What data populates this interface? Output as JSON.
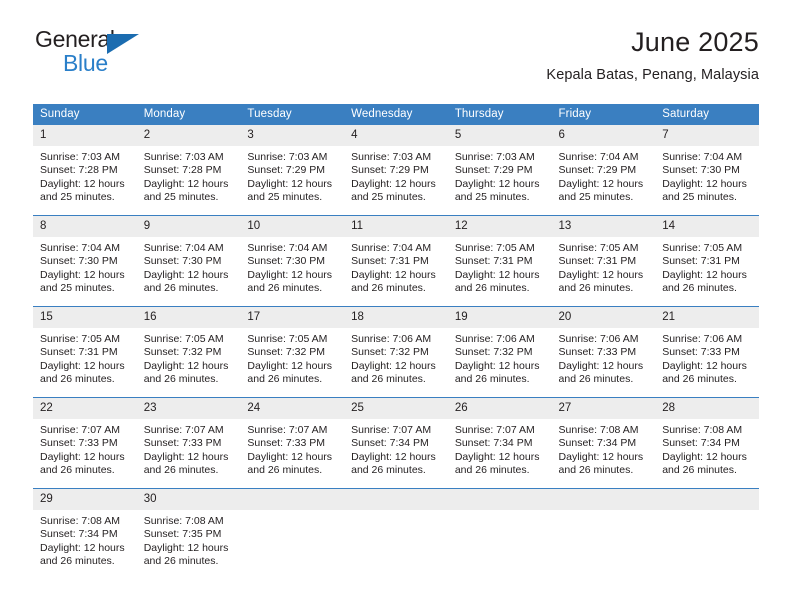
{
  "brand": {
    "name_part1": "General",
    "name_part2": "Blue",
    "triangle_color": "#1b6cb0",
    "blue_color": "#2a7fc9"
  },
  "header": {
    "title": "June 2025",
    "subtitle": "Kepala Batas, Penang, Malaysia"
  },
  "theme": {
    "header_bg": "#3a7fc1",
    "daynum_bg": "#ededed",
    "text": "#231f20",
    "row_divider": "#3a7fc1"
  },
  "weekdays": [
    "Sunday",
    "Monday",
    "Tuesday",
    "Wednesday",
    "Thursday",
    "Friday",
    "Saturday"
  ],
  "weeks": [
    [
      {
        "day": "1",
        "sunrise": "Sunrise: 7:03 AM",
        "sunset": "Sunset: 7:28 PM",
        "daylight1": "Daylight: 12 hours",
        "daylight2": "and 25 minutes."
      },
      {
        "day": "2",
        "sunrise": "Sunrise: 7:03 AM",
        "sunset": "Sunset: 7:28 PM",
        "daylight1": "Daylight: 12 hours",
        "daylight2": "and 25 minutes."
      },
      {
        "day": "3",
        "sunrise": "Sunrise: 7:03 AM",
        "sunset": "Sunset: 7:29 PM",
        "daylight1": "Daylight: 12 hours",
        "daylight2": "and 25 minutes."
      },
      {
        "day": "4",
        "sunrise": "Sunrise: 7:03 AM",
        "sunset": "Sunset: 7:29 PM",
        "daylight1": "Daylight: 12 hours",
        "daylight2": "and 25 minutes."
      },
      {
        "day": "5",
        "sunrise": "Sunrise: 7:03 AM",
        "sunset": "Sunset: 7:29 PM",
        "daylight1": "Daylight: 12 hours",
        "daylight2": "and 25 minutes."
      },
      {
        "day": "6",
        "sunrise": "Sunrise: 7:04 AM",
        "sunset": "Sunset: 7:29 PM",
        "daylight1": "Daylight: 12 hours",
        "daylight2": "and 25 minutes."
      },
      {
        "day": "7",
        "sunrise": "Sunrise: 7:04 AM",
        "sunset": "Sunset: 7:30 PM",
        "daylight1": "Daylight: 12 hours",
        "daylight2": "and 25 minutes."
      }
    ],
    [
      {
        "day": "8",
        "sunrise": "Sunrise: 7:04 AM",
        "sunset": "Sunset: 7:30 PM",
        "daylight1": "Daylight: 12 hours",
        "daylight2": "and 25 minutes."
      },
      {
        "day": "9",
        "sunrise": "Sunrise: 7:04 AM",
        "sunset": "Sunset: 7:30 PM",
        "daylight1": "Daylight: 12 hours",
        "daylight2": "and 26 minutes."
      },
      {
        "day": "10",
        "sunrise": "Sunrise: 7:04 AM",
        "sunset": "Sunset: 7:30 PM",
        "daylight1": "Daylight: 12 hours",
        "daylight2": "and 26 minutes."
      },
      {
        "day": "11",
        "sunrise": "Sunrise: 7:04 AM",
        "sunset": "Sunset: 7:31 PM",
        "daylight1": "Daylight: 12 hours",
        "daylight2": "and 26 minutes."
      },
      {
        "day": "12",
        "sunrise": "Sunrise: 7:05 AM",
        "sunset": "Sunset: 7:31 PM",
        "daylight1": "Daylight: 12 hours",
        "daylight2": "and 26 minutes."
      },
      {
        "day": "13",
        "sunrise": "Sunrise: 7:05 AM",
        "sunset": "Sunset: 7:31 PM",
        "daylight1": "Daylight: 12 hours",
        "daylight2": "and 26 minutes."
      },
      {
        "day": "14",
        "sunrise": "Sunrise: 7:05 AM",
        "sunset": "Sunset: 7:31 PM",
        "daylight1": "Daylight: 12 hours",
        "daylight2": "and 26 minutes."
      }
    ],
    [
      {
        "day": "15",
        "sunrise": "Sunrise: 7:05 AM",
        "sunset": "Sunset: 7:31 PM",
        "daylight1": "Daylight: 12 hours",
        "daylight2": "and 26 minutes."
      },
      {
        "day": "16",
        "sunrise": "Sunrise: 7:05 AM",
        "sunset": "Sunset: 7:32 PM",
        "daylight1": "Daylight: 12 hours",
        "daylight2": "and 26 minutes."
      },
      {
        "day": "17",
        "sunrise": "Sunrise: 7:05 AM",
        "sunset": "Sunset: 7:32 PM",
        "daylight1": "Daylight: 12 hours",
        "daylight2": "and 26 minutes."
      },
      {
        "day": "18",
        "sunrise": "Sunrise: 7:06 AM",
        "sunset": "Sunset: 7:32 PM",
        "daylight1": "Daylight: 12 hours",
        "daylight2": "and 26 minutes."
      },
      {
        "day": "19",
        "sunrise": "Sunrise: 7:06 AM",
        "sunset": "Sunset: 7:32 PM",
        "daylight1": "Daylight: 12 hours",
        "daylight2": "and 26 minutes."
      },
      {
        "day": "20",
        "sunrise": "Sunrise: 7:06 AM",
        "sunset": "Sunset: 7:33 PM",
        "daylight1": "Daylight: 12 hours",
        "daylight2": "and 26 minutes."
      },
      {
        "day": "21",
        "sunrise": "Sunrise: 7:06 AM",
        "sunset": "Sunset: 7:33 PM",
        "daylight1": "Daylight: 12 hours",
        "daylight2": "and 26 minutes."
      }
    ],
    [
      {
        "day": "22",
        "sunrise": "Sunrise: 7:07 AM",
        "sunset": "Sunset: 7:33 PM",
        "daylight1": "Daylight: 12 hours",
        "daylight2": "and 26 minutes."
      },
      {
        "day": "23",
        "sunrise": "Sunrise: 7:07 AM",
        "sunset": "Sunset: 7:33 PM",
        "daylight1": "Daylight: 12 hours",
        "daylight2": "and 26 minutes."
      },
      {
        "day": "24",
        "sunrise": "Sunrise: 7:07 AM",
        "sunset": "Sunset: 7:33 PM",
        "daylight1": "Daylight: 12 hours",
        "daylight2": "and 26 minutes."
      },
      {
        "day": "25",
        "sunrise": "Sunrise: 7:07 AM",
        "sunset": "Sunset: 7:34 PM",
        "daylight1": "Daylight: 12 hours",
        "daylight2": "and 26 minutes."
      },
      {
        "day": "26",
        "sunrise": "Sunrise: 7:07 AM",
        "sunset": "Sunset: 7:34 PM",
        "daylight1": "Daylight: 12 hours",
        "daylight2": "and 26 minutes."
      },
      {
        "day": "27",
        "sunrise": "Sunrise: 7:08 AM",
        "sunset": "Sunset: 7:34 PM",
        "daylight1": "Daylight: 12 hours",
        "daylight2": "and 26 minutes."
      },
      {
        "day": "28",
        "sunrise": "Sunrise: 7:08 AM",
        "sunset": "Sunset: 7:34 PM",
        "daylight1": "Daylight: 12 hours",
        "daylight2": "and 26 minutes."
      }
    ],
    [
      {
        "day": "29",
        "sunrise": "Sunrise: 7:08 AM",
        "sunset": "Sunset: 7:34 PM",
        "daylight1": "Daylight: 12 hours",
        "daylight2": "and 26 minutes."
      },
      {
        "day": "30",
        "sunrise": "Sunrise: 7:08 AM",
        "sunset": "Sunset: 7:35 PM",
        "daylight1": "Daylight: 12 hours",
        "daylight2": "and 26 minutes."
      },
      {
        "day": "",
        "sunrise": "",
        "sunset": "",
        "daylight1": "",
        "daylight2": ""
      },
      {
        "day": "",
        "sunrise": "",
        "sunset": "",
        "daylight1": "",
        "daylight2": ""
      },
      {
        "day": "",
        "sunrise": "",
        "sunset": "",
        "daylight1": "",
        "daylight2": ""
      },
      {
        "day": "",
        "sunrise": "",
        "sunset": "",
        "daylight1": "",
        "daylight2": ""
      },
      {
        "day": "",
        "sunrise": "",
        "sunset": "",
        "daylight1": "",
        "daylight2": ""
      }
    ]
  ]
}
